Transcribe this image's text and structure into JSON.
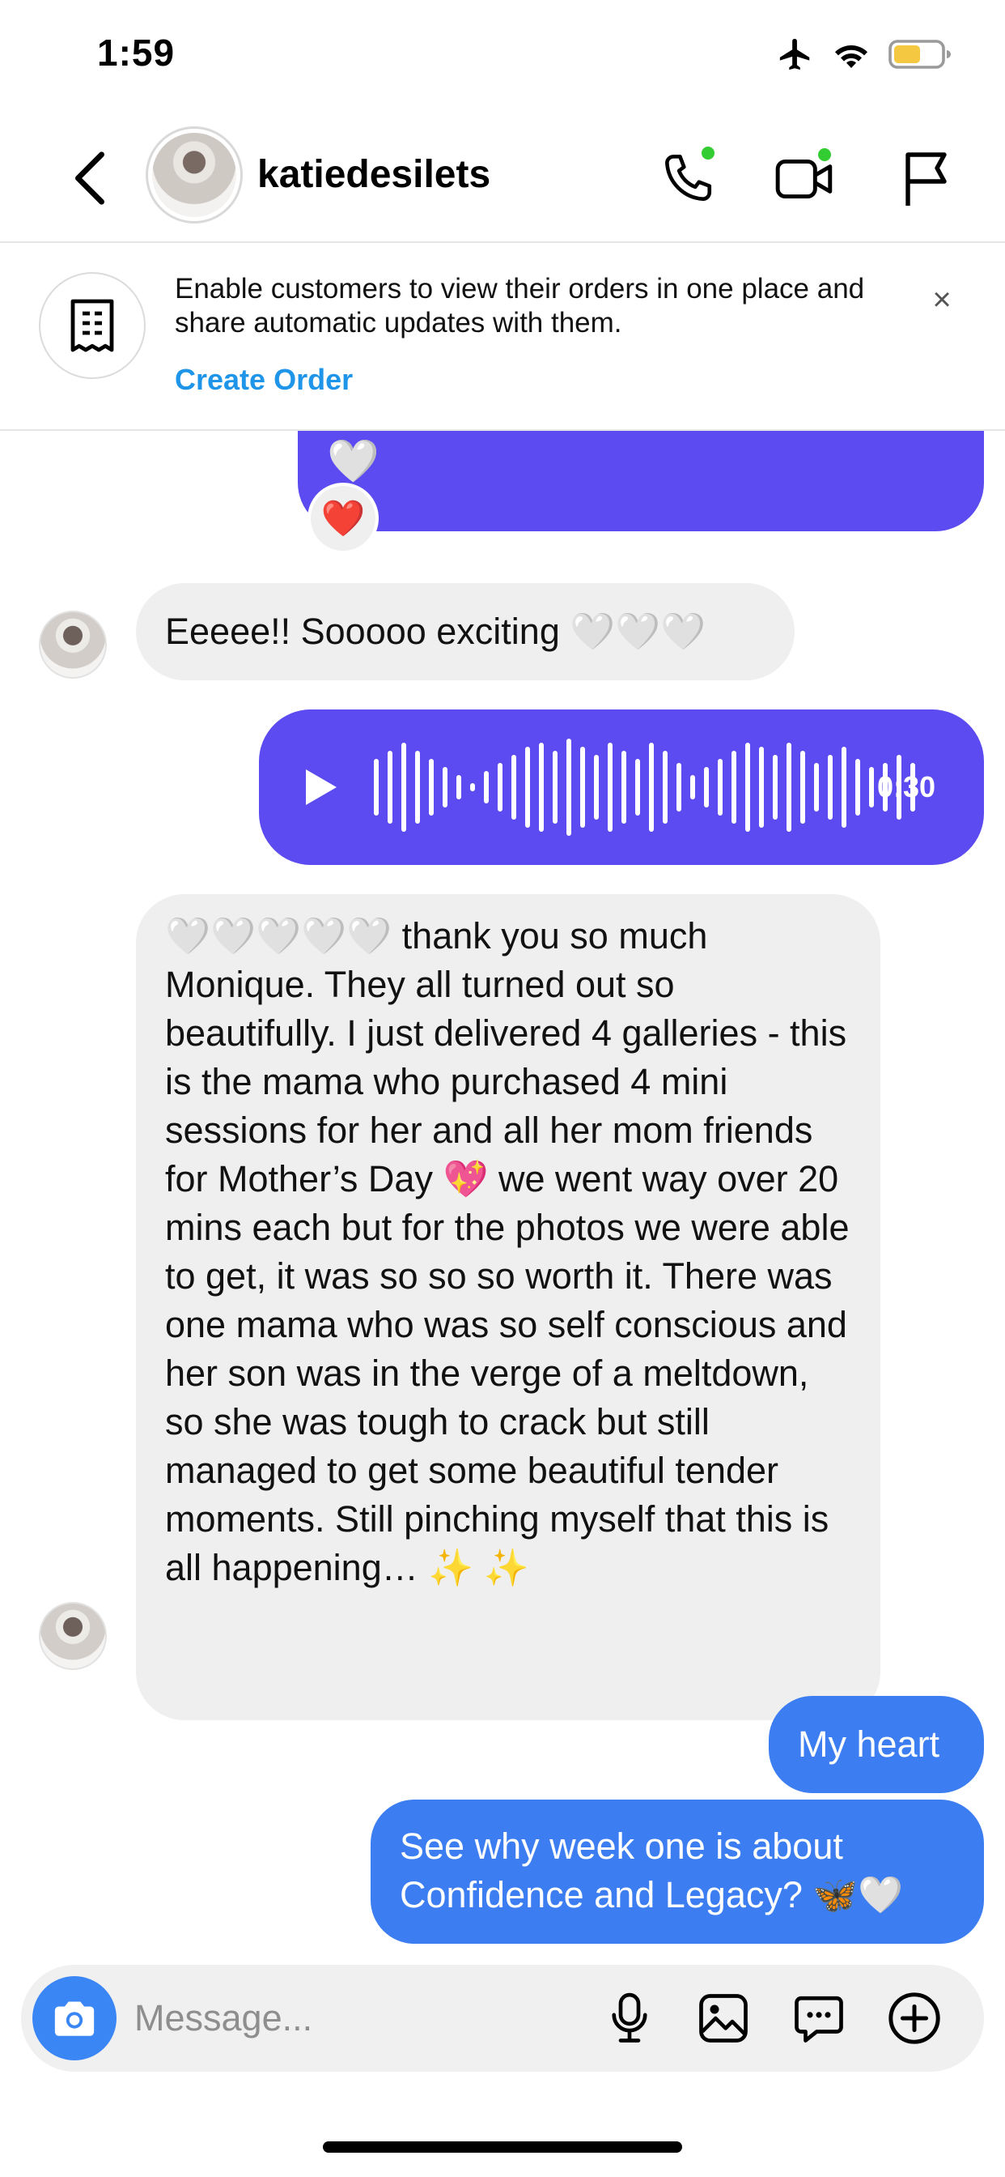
{
  "status_bar": {
    "time": "1:59"
  },
  "header": {
    "username": "katiedesilets"
  },
  "banner": {
    "text": "Enable customers to view their orders in one place and share automatic updates with them.",
    "link": "Create Order",
    "close": "×"
  },
  "messages": {
    "top_hearts": "🤍",
    "reaction": "❤️",
    "msg1": "Eeeee!! Sooooo exciting",
    "msg1_emoji": "🤍🤍🤍",
    "voice_duration": "0:30",
    "long_emoji": "🤍🤍🤍🤍🤍",
    "long_text": " thank you so much Monique. They all turned out so beautifully. I just delivered 4 galleries - this is the mama who purchased 4 mini sessions for her and all her mom friends for Mother’s Day 💖 we went way over 20 mins each but for the photos we were able to get, it was so so so worth it. There was one mama who was so self conscious and her son was in the verge of a meltdown, so she was tough to crack but still managed to get some beautiful tender moments. Still pinching myself that this is all happening… ✨ ✨",
    "reply1": "My heart",
    "reply2": "See why week one is about Confidence and Legacy? 🦋🤍"
  },
  "composer": {
    "placeholder": "Message..."
  },
  "icons": {
    "status": [
      "airplane-icon",
      "wifi-icon",
      "battery-icon"
    ],
    "header": [
      "back-icon",
      "phone-icon",
      "video-icon",
      "flag-icon"
    ],
    "composer": [
      "camera-icon",
      "microphone-icon",
      "gallery-icon",
      "sticker-icon",
      "plus-icon"
    ]
  },
  "colors": {
    "purple": "#5b4bf0",
    "blue": "#3c7ef2",
    "link": "#1e95e8",
    "online": "#33cc33",
    "battery": "#f5c842"
  }
}
